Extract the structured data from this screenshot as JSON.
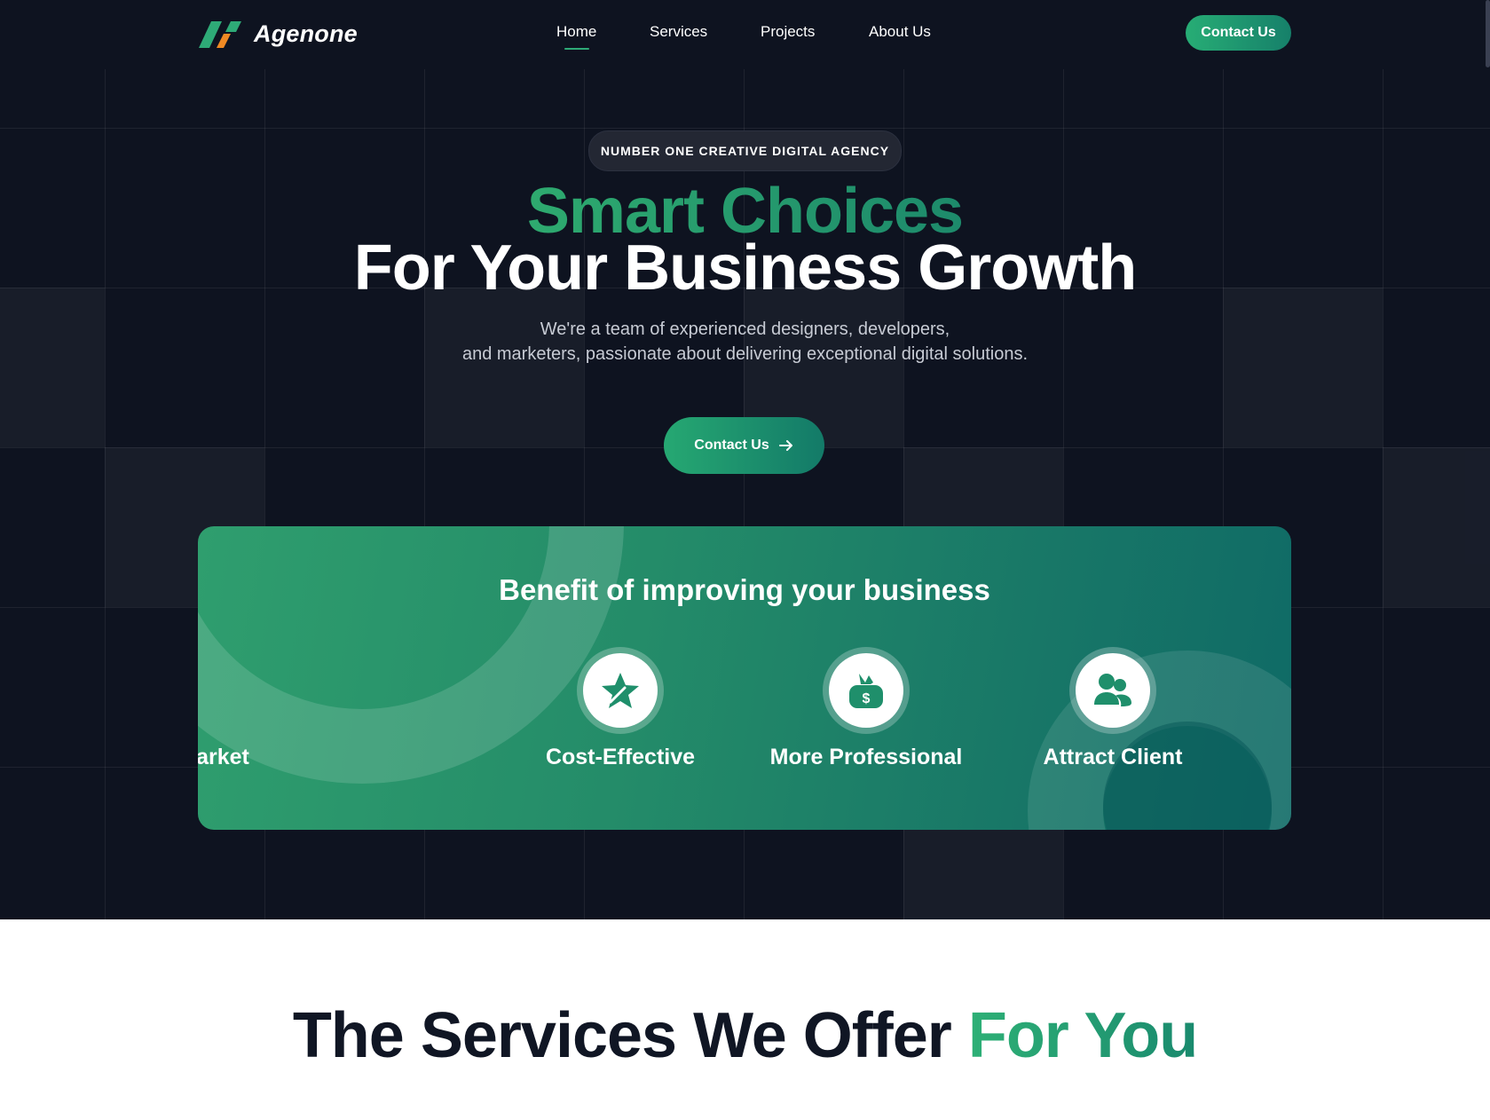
{
  "brand": {
    "name": "Agenone",
    "primary": "#2eaa77",
    "dark_bg": "#0e1320"
  },
  "nav": {
    "items": [
      {
        "label": "Home",
        "active": true
      },
      {
        "label": "Services",
        "active": false
      },
      {
        "label": "Projects",
        "active": false
      },
      {
        "label": "About Us",
        "active": false
      }
    ],
    "cta_label": "Contact Us"
  },
  "hero": {
    "badge": "NUMBER ONE CREATIVE DIGITAL AGENCY",
    "title_highlight": "Smart Choices",
    "title_main": "For Your Business Growth",
    "subtitle_line1": "We're a team of experienced designers, developers,",
    "subtitle_line2": "and marketers, passionate about delivering exceptional digital solutions.",
    "cta_label": "Contact Us",
    "cta_icon": "arrow-right-icon"
  },
  "benefits": {
    "title": "Benefit of improving your business",
    "items": [
      {
        "label": "Expanding the Market",
        "icon": "expand-arrows-icon"
      },
      {
        "label": "Cost-Effective",
        "icon": "star-icon"
      },
      {
        "label": "More Professional",
        "icon": "money-bag-icon"
      },
      {
        "label": "Attract Client",
        "icon": "users-icon"
      }
    ]
  },
  "services": {
    "title_main": "The Services We Offer",
    "title_accent": "For You"
  }
}
